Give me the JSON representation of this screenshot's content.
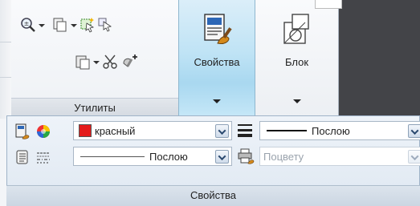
{
  "ribbon": {
    "utilities_panel": {
      "title": "Утилиты"
    },
    "properties_button": {
      "label": "Свойства"
    },
    "block_button": {
      "label": "Блок"
    }
  },
  "properties_panel": {
    "title": "Свойства",
    "color_combo": {
      "value": "красный",
      "swatch_color": "#e41b1b"
    },
    "lineweight_combo": {
      "value": "Послою"
    },
    "linetype_combo": {
      "value": "Послою"
    },
    "plotstyle_combo": {
      "value": "Поцвету",
      "disabled": true
    }
  },
  "colors": {
    "accent_blue": "#bfe3f5",
    "dark_canvas": "#434448"
  }
}
